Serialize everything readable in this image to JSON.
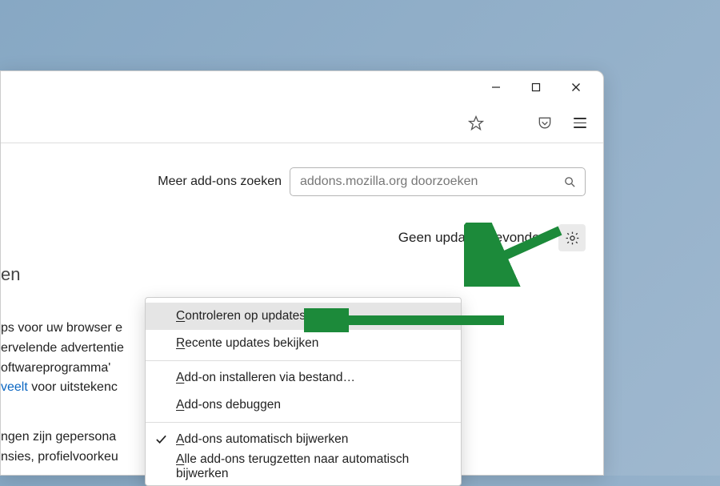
{
  "window": {
    "minimize": "−",
    "maximize": "□",
    "close": "✕"
  },
  "search": {
    "label": "Meer add-ons zoeken",
    "placeholder": "addons.mozilla.org doorzoeken"
  },
  "status": {
    "text": "Geen updates gevonden"
  },
  "heading_fragment": "en",
  "body1": {
    "l1": "ps voor uw browser e",
    "l2": "ervelende advertentie",
    "l3": "oftwareprogramma'",
    "l4_link": "veelt",
    "l4_rest": " voor uitstekenc"
  },
  "body2": {
    "l1": "ngen zijn gepersona",
    "l2": "nsies, profielvoorkeu"
  },
  "menu": {
    "items": [
      {
        "underline": "C",
        "rest": "ontroleren op updates",
        "hover": true
      },
      {
        "underline": "R",
        "rest": "ecente updates bekijken"
      },
      {
        "sep": true
      },
      {
        "underline": "A",
        "rest": "dd-on installeren via bestand…"
      },
      {
        "underline": "A",
        "rest": "dd-ons debuggen"
      },
      {
        "sep": true
      },
      {
        "check": true,
        "underline": "A",
        "rest": "dd-ons automatisch bijwerken"
      },
      {
        "underline": "A",
        "rest": "lle add-ons terugzetten naar automatisch bijwerken"
      }
    ]
  },
  "annotation": {
    "arrow_color": "#1c8a3a"
  }
}
